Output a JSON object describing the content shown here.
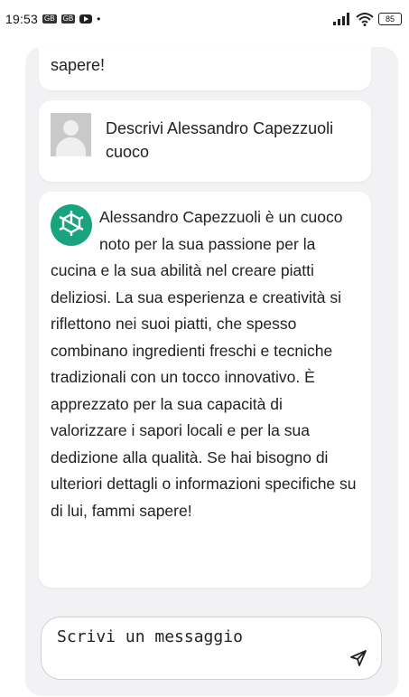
{
  "status_bar": {
    "time": "19:53",
    "notif_1": "GB",
    "notif_2": "GB",
    "dot": "•",
    "battery": "85"
  },
  "chat": {
    "prev_message_tail": "sapere!",
    "user_message": "Descrivi Alessandro Capezzuoli cuoco",
    "assistant_message": "Alessandro Capezzuoli è un cuoco noto per la sua passione per la cucina e la sua abilità nel creare piatti deliziosi. La sua esperienza e creatività si riflettono nei suoi piatti, che spesso combinano ingredienti freschi e tecniche tradizionali con un tocco innovativo. È apprezzato per la sua capacità di valorizzare i sapori locali e per la sua dedizione alla qualità. Se hai bisogno di ulteriori dettagli o informazioni specifiche su di lui, fammi sapere!"
  },
  "composer": {
    "placeholder": "Scrivi un messaggio"
  },
  "icons": {
    "signal": "signal-icon",
    "wifi": "wifi-icon",
    "battery": "battery-icon",
    "user_avatar": "user-avatar-icon",
    "bot_avatar": "openai-logo-icon",
    "send": "send-icon"
  },
  "colors": {
    "bot_avatar_bg": "#19a37f",
    "frame_bg": "#f2f2f4",
    "bubble_bg": "#ffffff"
  }
}
